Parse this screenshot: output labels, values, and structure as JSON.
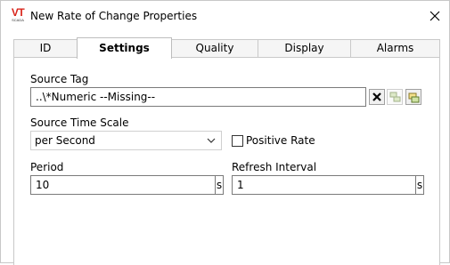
{
  "window": {
    "title": "New Rate of Change Properties",
    "logo_text": "VT",
    "logo_subtext": "SCADA"
  },
  "tabs": [
    {
      "label": "ID",
      "active": false
    },
    {
      "label": "Settings",
      "active": true
    },
    {
      "label": "Quality",
      "active": false
    },
    {
      "label": "Display",
      "active": false
    },
    {
      "label": "Alarms",
      "active": false
    }
  ],
  "settings": {
    "source_tag": {
      "label": "Source Tag",
      "value": "..\\*Numeric    --Missing--"
    },
    "source_time_scale": {
      "label": "Source Time Scale",
      "selected": "per Second"
    },
    "positive_rate": {
      "label": "Positive Rate",
      "checked": false
    },
    "period": {
      "label": "Period",
      "value": "10",
      "unit": "s"
    },
    "refresh_interval": {
      "label": "Refresh Interval",
      "value": "1",
      "unit": "s"
    }
  },
  "colors": {
    "logo_red": "#d9261c",
    "border": "#7a7a7a",
    "tab_border": "#c9c9c9"
  }
}
